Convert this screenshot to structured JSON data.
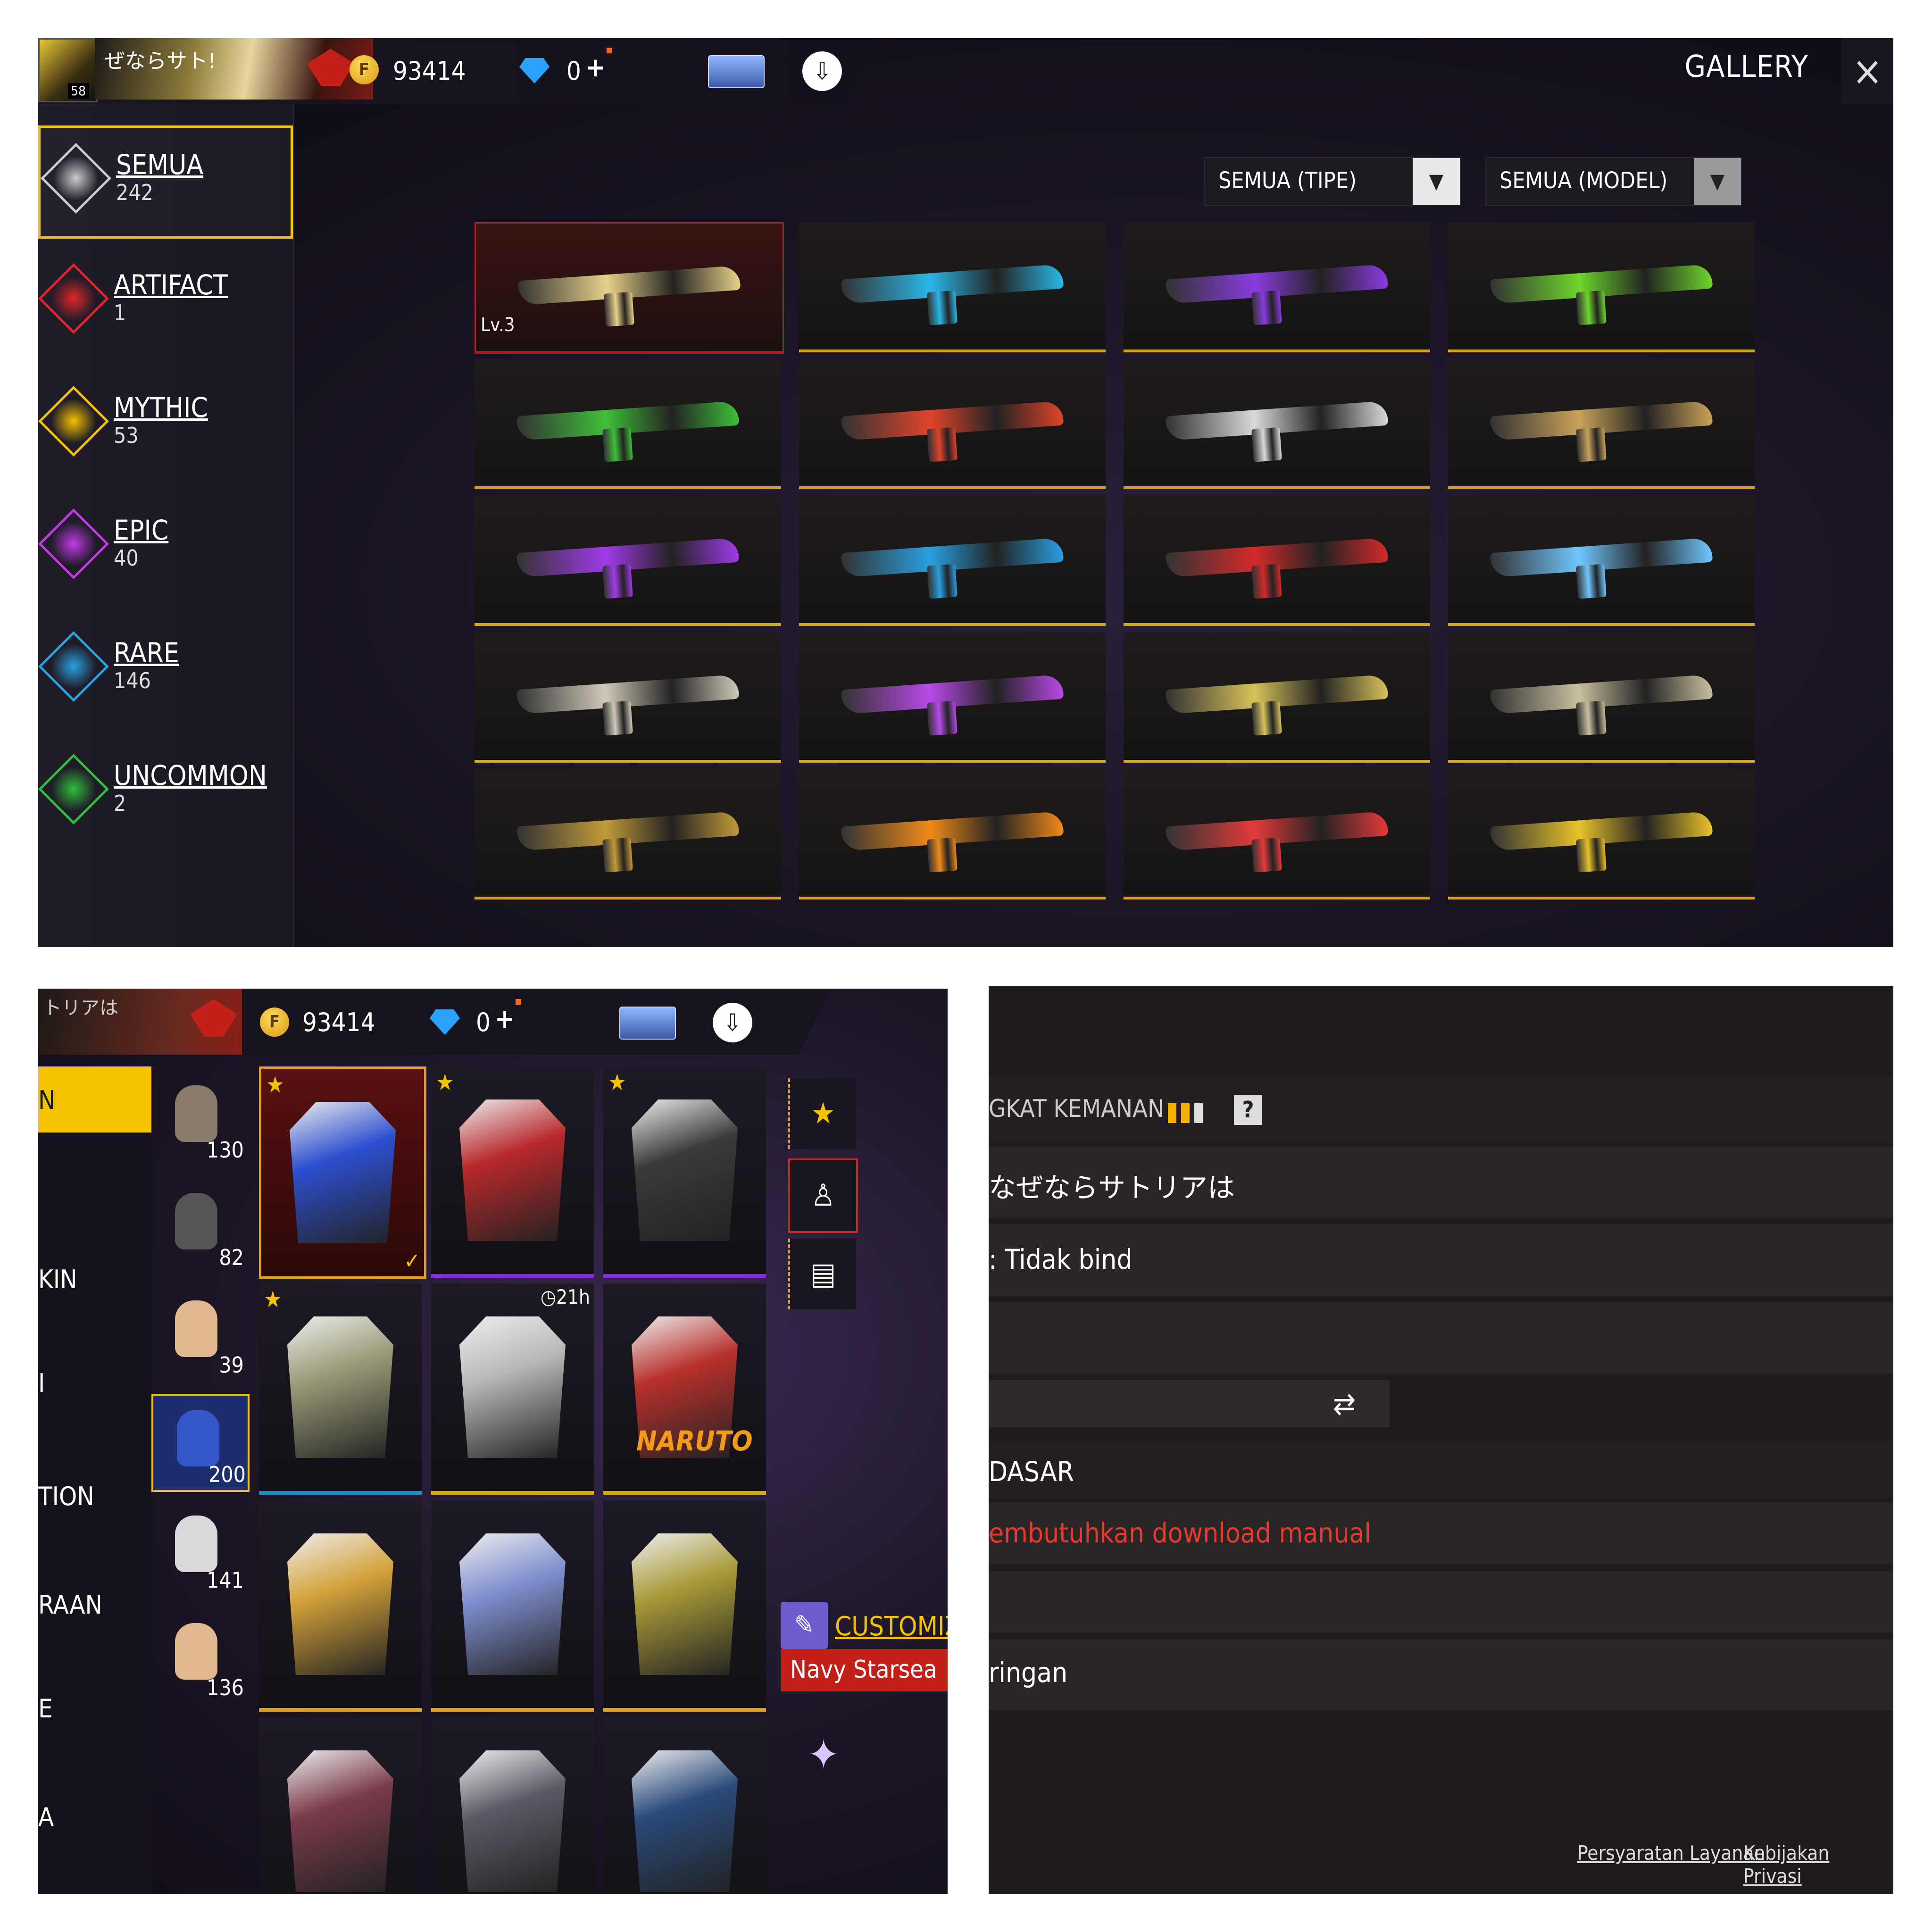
{
  "gallery": {
    "player_level": "58",
    "player_name": "ぜならサト!",
    "coins": "93414",
    "diamonds": "0",
    "plus": "+",
    "title": "GALLERY",
    "close_icon": "×",
    "sidebar": [
      {
        "label": "SEMUA",
        "count": "242",
        "color": "#cccccc"
      },
      {
        "label": "ARTIFACT",
        "count": "1",
        "color": "#e0262b"
      },
      {
        "label": "MYTHIC",
        "count": "53",
        "color": "#f5c200"
      },
      {
        "label": "EPIC",
        "count": "40",
        "color": "#c23ae8"
      },
      {
        "label": "RARE",
        "count": "146",
        "color": "#29a3e0"
      },
      {
        "label": "UNCOMMON",
        "count": "2",
        "color": "#2fbf3a"
      }
    ],
    "filter_type": "SEMUA (TIPE)",
    "filter_model": "SEMUA (MODEL)",
    "first_weapon_level": "Lv.3",
    "weapon_colors": [
      "#e8d18a",
      "#2bb7e8",
      "#8a3be0",
      "#6ed62c",
      "#3fbf3a",
      "#e0442a",
      "#d9d9d9",
      "#c9a25a",
      "#a13ae8",
      "#2a9fe0",
      "#d32a2a",
      "#6fc7ff",
      "#cfc9b8",
      "#b84ae8",
      "#d8c25a",
      "#c9c0a0",
      "#c29a3a",
      "#f08a1a",
      "#e33a3a",
      "#e8c22a"
    ]
  },
  "wardrobe": {
    "banner_text": "トリアは",
    "coins": "93414",
    "diamonds": "0",
    "plus": "+",
    "categories": [
      "N",
      "KIN",
      "I",
      "TION",
      "RAAN",
      "E",
      "A"
    ],
    "parts": [
      {
        "count": "130",
        "color": "#8a7a6a"
      },
      {
        "count": "82",
        "color": "#555555"
      },
      {
        "count": "39",
        "color": "#e2b98f"
      },
      {
        "count": "200",
        "color": "#3556c8"
      },
      {
        "count": "141",
        "color": "#d9d9d9"
      },
      {
        "count": "136",
        "color": "#e2b98f"
      }
    ],
    "outfits": [
      {
        "color": "#2d4fd0",
        "star": true,
        "timer": "",
        "selected": true,
        "bar": "sel"
      },
      {
        "color": "#b8282b",
        "star": true,
        "timer": "",
        "selected": false,
        "bar": "purple"
      },
      {
        "color": "#3a3a3a",
        "star": true,
        "timer": "",
        "selected": false,
        "bar": "purple"
      },
      {
        "color": "#9a9a78",
        "star": true,
        "timer": "",
        "selected": false,
        "bar": "blue"
      },
      {
        "color": "#b8b8b8",
        "star": false,
        "timer": "21h",
        "selected": false,
        "bar": "gold"
      },
      {
        "color": "#b8302b",
        "star": false,
        "timer": "",
        "selected": false,
        "bar": "gold"
      },
      {
        "color": "#d4a23a",
        "star": false,
        "timer": "",
        "selected": false,
        "bar": "gold"
      },
      {
        "color": "#7f8fcf",
        "star": false,
        "timer": "",
        "selected": false,
        "bar": "gold"
      },
      {
        "color": "#a89a38",
        "star": false,
        "timer": "",
        "selected": false,
        "bar": "gold"
      },
      {
        "color": "#7a3a4a",
        "star": false,
        "timer": "",
        "selected": false,
        "bar": "none"
      },
      {
        "color": "#5a5a66",
        "star": false,
        "timer": "",
        "selected": false,
        "bar": "none"
      },
      {
        "color": "#2a4a7a",
        "star": false,
        "timer": "",
        "selected": false,
        "bar": "none"
      }
    ],
    "naruto_logo": "NARUTO",
    "check_icon": "✓",
    "star_glyph": "★",
    "timer_glyph": "◷",
    "customize_label": "CUSTOMIZE",
    "outfit_name": "Navy Starsea",
    "shirt_glyph": "👕"
  },
  "settings": {
    "security_label": "GKAT KEMANAN",
    "help_glyph": "?",
    "nickname": "なぜならサトリアは",
    "bind_status": ": Tidak bind",
    "swap_glyph": "⇄",
    "dasar_label": "DASAR",
    "download_notice": "embutuhkan download manual",
    "light_label": "ringan",
    "terms_link": "Persyaratan Layanan",
    "privacy_link": "Kebijakan Privasi"
  }
}
